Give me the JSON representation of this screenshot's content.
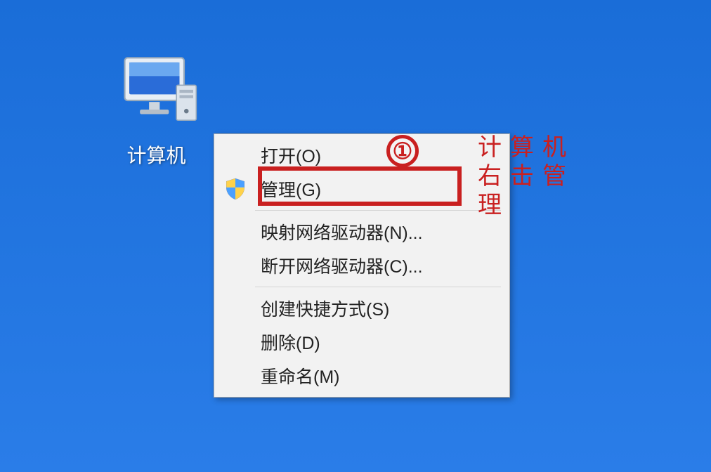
{
  "desktop": {
    "computer_icon_label": "计算机"
  },
  "context_menu": {
    "items": {
      "open": "打开(O)",
      "manage": "管理(G)",
      "map_drive": "映射网络驱动器(N)...",
      "disconnect_drive": "断开网络驱动器(C)...",
      "create_shortcut": "创建快捷方式(S)",
      "delete": "删除(D)",
      "rename": "重命名(M)"
    }
  },
  "annotations": {
    "circle_number": "①",
    "hint_text": "计算机右击管理"
  }
}
